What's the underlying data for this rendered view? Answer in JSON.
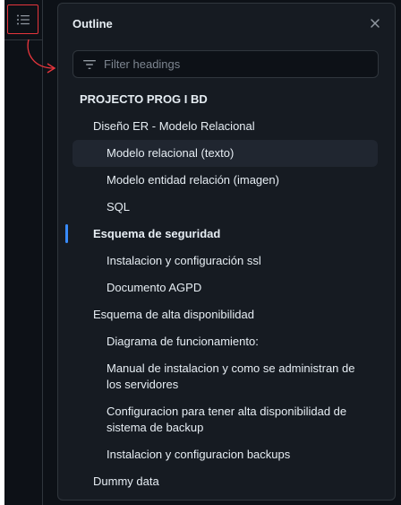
{
  "panel": {
    "title": "Outline",
    "filter_placeholder": "Filter headings"
  },
  "headings": [
    {
      "label": "PROJECTO PROG I BD",
      "level": 1
    },
    {
      "label": "Diseño ER - Modelo Relacional",
      "level": 2
    },
    {
      "label": "Modelo relacional (texto)",
      "level": 3,
      "state": "hover"
    },
    {
      "label": "Modelo entidad relación (imagen)",
      "level": 3
    },
    {
      "label": "SQL",
      "level": 3
    },
    {
      "label": "Esquema de seguridad",
      "level": 2,
      "state": "active"
    },
    {
      "label": "Instalacion y configuración ssl",
      "level": 3
    },
    {
      "label": "Documento AGPD",
      "level": 3
    },
    {
      "label": "Esquema de alta disponibilidad",
      "level": 2
    },
    {
      "label": "Diagrama de funcionamiento:",
      "level": 3
    },
    {
      "label": "Manual de instalacion y como se administran de los servidores",
      "level": 3
    },
    {
      "label": "Configuracion para tener alta disponibilidad de sistema de backup",
      "level": 3
    },
    {
      "label": "Instalacion y configuracion backups",
      "level": 3
    },
    {
      "label": "Dummy data",
      "level": 2
    }
  ],
  "icons": {
    "toggle": "list-unordered-icon",
    "close": "close-icon",
    "filter": "filter-icon"
  },
  "colors": {
    "background": "#0d1117",
    "panel": "#161b22",
    "border": "#30363d",
    "text": "#e6edf3",
    "muted": "#7d8590",
    "accent": "#388bfd",
    "annotation": "#e5353c"
  }
}
